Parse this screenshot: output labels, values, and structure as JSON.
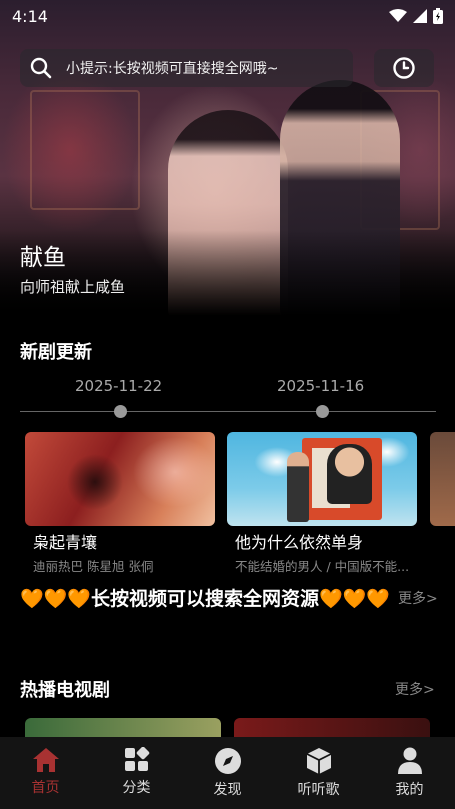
{
  "status_bar": {
    "time": "4:14"
  },
  "search": {
    "placeholder_text": "小提示:长按视频可直接搜全网哦~"
  },
  "hero": {
    "title": "献鱼",
    "subtitle": "向师祖献上咸鱼"
  },
  "new_dramas": {
    "title": "新剧更新",
    "dates": [
      "2025-11-22",
      "2025-11-16"
    ],
    "cards": [
      {
        "name": "枭起青壤",
        "actors": "迪丽热巴 陈星旭 张侗"
      },
      {
        "name": "他为什么依然单身",
        "actors": "不能结婚的男人 / 中国版不能..."
      }
    ]
  },
  "promo": {
    "hearts_left": "🧡🧡🧡",
    "text": "长按视频可以搜索全网资源",
    "hearts_right": "🧡🧡🧡",
    "more": "更多>"
  },
  "hot_tv": {
    "title": "热播电视剧",
    "more": "更多>"
  },
  "nav": {
    "items": [
      {
        "label": "首页",
        "icon": "home-icon",
        "active": true
      },
      {
        "label": "分类",
        "icon": "category-grid-icon"
      },
      {
        "label": "发现",
        "icon": "compass-icon"
      },
      {
        "label": "听听歌",
        "icon": "box-icon"
      },
      {
        "label": "我的",
        "icon": "person-icon"
      }
    ]
  },
  "colors": {
    "accent": "#a83232",
    "heart": "#f07a2c",
    "muted": "#888888",
    "nav_bg": "#141414"
  }
}
